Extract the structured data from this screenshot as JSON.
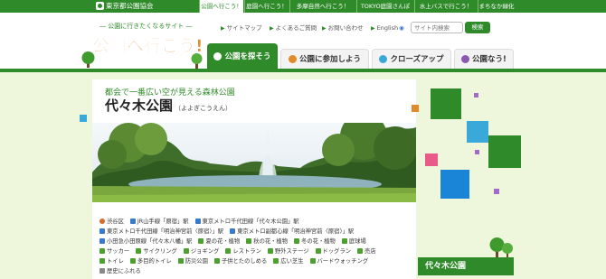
{
  "top_bar": {
    "org_name": "東京都公園協会",
    "links": [
      "公園へ行こう！",
      "庭園へ行こう！",
      "多摩自然へ行こう！",
      "TOKYO庭園さんぽ",
      "水上バスで行こう！",
      "まちなか緑化"
    ]
  },
  "header": {
    "tagline": "― 公園に行きたくなるサイト ―",
    "logo_text": "公園へ行こう!",
    "utility_links": [
      "サイトマップ",
      "よくあるご質問",
      "お問い合わせ",
      "English"
    ],
    "search": {
      "placeholder": "サイト内検索",
      "button_label": "検索"
    },
    "tabs": [
      "公園を探そう",
      "公園に参加しよう",
      "クローズアップ",
      "公園なう!"
    ]
  },
  "main": {
    "subtitle": "都会で一番広い空が見える森林公園",
    "park_name": "代々木公園",
    "park_reading": "（よよぎこうえん）",
    "info_rows": [
      [
        {
          "icon": "pin-icon",
          "text": "渋谷区"
        },
        {
          "icon": "train-icon",
          "text": "JR山手線「原宿」駅"
        },
        {
          "icon": "train-icon",
          "text": "東京メトロ千代田線「代々木公園」駅"
        }
      ],
      [
        {
          "icon": "train-icon",
          "text": "東京メトロ千代田線「明治神宮前〈原宿〉」駅"
        },
        {
          "icon": "train-icon",
          "text": "東京メトロ副都心線「明治神宮前〈原宿〉」駅"
        }
      ],
      [
        {
          "icon": "train-icon",
          "text": "小田急小田原線「代々木八幡」駅"
        },
        {
          "icon": "flower-icon",
          "text": "夏の花・植物"
        },
        {
          "icon": "flower-icon",
          "text": "秋の花・植物"
        },
        {
          "icon": "flower-icon",
          "text": "冬の花・植物"
        },
        {
          "icon": "court-icon",
          "text": "庭球場"
        }
      ],
      [
        {
          "icon": "soccer-icon",
          "text": "サッカー"
        },
        {
          "icon": "cycling-icon",
          "text": "サイクリング"
        },
        {
          "icon": "jogging-icon",
          "text": "ジョギング"
        },
        {
          "icon": "restaurant-icon",
          "text": "レストラン"
        },
        {
          "icon": "stage-icon",
          "text": "野外ステージ"
        },
        {
          "icon": "dog-icon",
          "text": "ドッグラン"
        },
        {
          "icon": "shop-icon",
          "text": "売店"
        }
      ],
      [
        {
          "icon": "toilet-icon",
          "text": "トイレ"
        },
        {
          "icon": "accessible-toilet-icon",
          "text": "多目的トイレ"
        },
        {
          "icon": "disaster-park-icon",
          "text": "防災公園"
        },
        {
          "icon": "kids-icon",
          "text": "子供とたのしめる"
        },
        {
          "icon": "lawn-icon",
          "text": "広い芝生"
        },
        {
          "icon": "bird-icon",
          "text": "バードウォッチング"
        }
      ],
      [
        {
          "icon": "history-icon",
          "text": "歴史にふれる"
        }
      ]
    ]
  },
  "side": {
    "caption": "代々木公園"
  },
  "colors": {
    "brand_green": "#2f8a2a",
    "light_bg": "#eef6dc"
  }
}
